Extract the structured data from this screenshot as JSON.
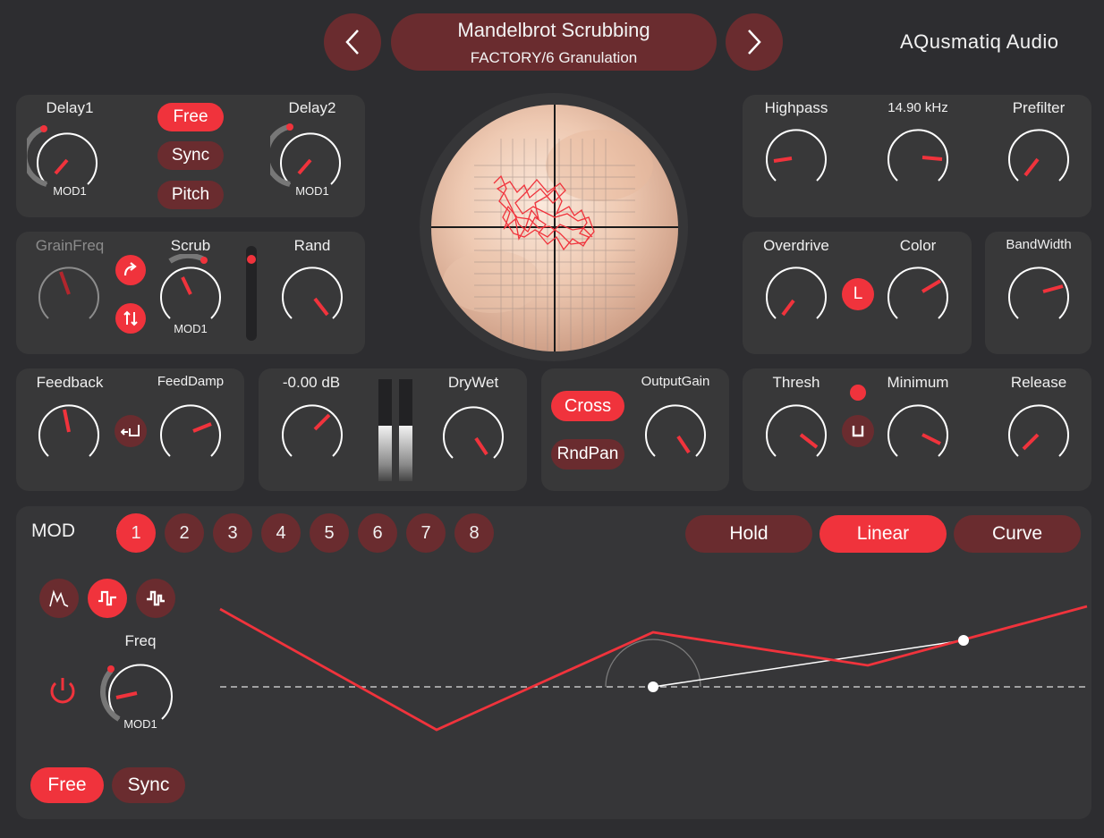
{
  "header": {
    "preset_name": "Mandelbrot Scrubbing",
    "preset_bank": "FACTORY/6 Granulation",
    "brand": "AQusmatiq Audio"
  },
  "delay": {
    "delay1_label": "Delay1",
    "delay2_label": "Delay2",
    "mod_tag1": "MOD1",
    "mod_tag2": "MOD1",
    "free_label": "Free",
    "sync_label": "Sync",
    "pitch_label": "Pitch"
  },
  "grain": {
    "grainfreq_label": "GrainFreq",
    "scrub_label": "Scrub",
    "scrub_mod": "MOD1",
    "rand_label": "Rand"
  },
  "feedback": {
    "feedback_label": "Feedback",
    "feeddamp_label": "FeedDamp"
  },
  "levels": {
    "gain_readout": "-0.00 dB",
    "drywet_label": "DryWet"
  },
  "output": {
    "cross_label": "Cross",
    "rndpan_label": "RndPan",
    "outputgain_label": "OutputGain"
  },
  "filter": {
    "highpass_label": "Highpass",
    "freq_readout": "14.90 kHz",
    "prefilter_label": "Prefilter"
  },
  "drive": {
    "overdrive_label": "Overdrive",
    "color_label": "Color",
    "l_label": "L",
    "bandwidth_label": "BandWidth"
  },
  "dynamics": {
    "thresh_label": "Thresh",
    "minimum_label": "Minimum",
    "release_label": "Release"
  },
  "mod": {
    "title": "MOD",
    "slots": [
      "1",
      "2",
      "3",
      "4",
      "5",
      "6",
      "7",
      "8"
    ],
    "active_slot": "1",
    "curve_modes": [
      "Hold",
      "Linear",
      "Curve"
    ],
    "active_mode": "Linear",
    "freq_label": "Freq",
    "freq_mod": "MOD1",
    "free_label": "Free",
    "sync_label": "Sync"
  },
  "colors": {
    "accent": "#f0333c",
    "button_dark": "#6a2c2f",
    "panel": "#383839",
    "background": "#2d2d30"
  }
}
